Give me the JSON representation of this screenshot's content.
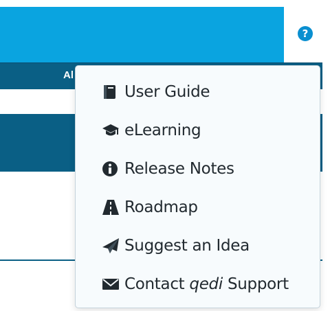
{
  "header": {
    "nav_label": "Al"
  },
  "help_button": {
    "glyph": "?",
    "icon": "question-circle-icon"
  },
  "menu": {
    "items": [
      {
        "label": "User Guide",
        "icon": "book-icon"
      },
      {
        "label": "eLearning",
        "icon": "graduation-cap-icon"
      },
      {
        "label": "Release Notes",
        "icon": "info-circle-icon"
      },
      {
        "label": "Roadmap",
        "icon": "road-icon"
      },
      {
        "label": "Suggest an Idea",
        "icon": "paper-plane-icon"
      },
      {
        "label_prefix": "Contact ",
        "label_brand": "qedi",
        "label_suffix": " Support",
        "icon": "envelope-icon"
      }
    ]
  },
  "colors": {
    "accent": "#0aa4e0",
    "dark": "#0a5f85",
    "menu_bg": "#f7fbfd",
    "text": "#222a30"
  }
}
